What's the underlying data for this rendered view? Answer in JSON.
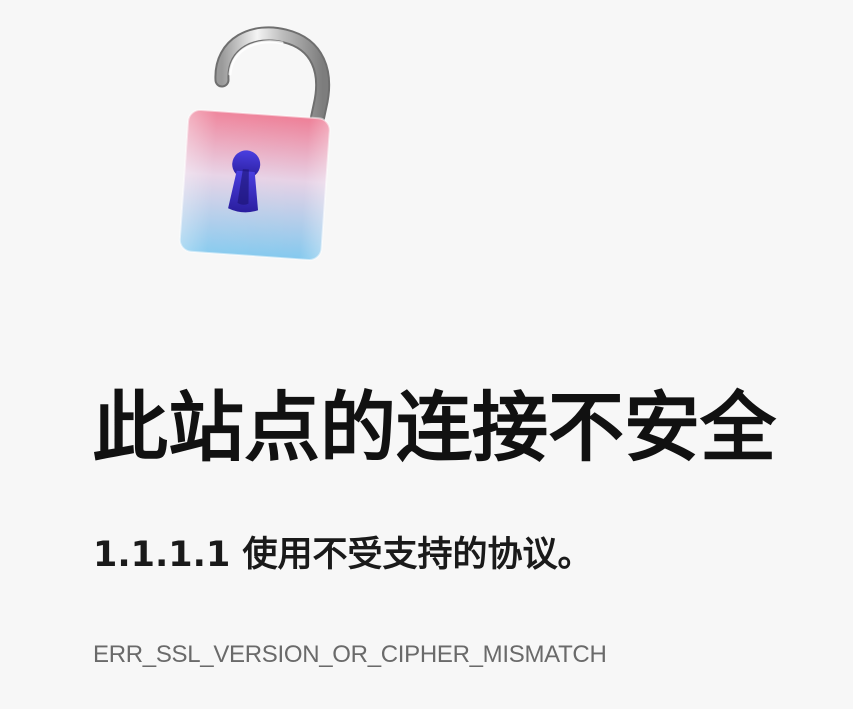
{
  "error_page": {
    "icon": "unlocked-padlock-icon",
    "title": "此站点的连接不安全",
    "description": "1.1.1.1 使用不受支持的协议。",
    "error_code": "ERR_SSL_VERSION_OR_CIPHER_MISMATCH"
  },
  "colors": {
    "background": "#f7f7f7",
    "title": "#111111",
    "error_code": "#6a6a6a",
    "lock_top": "#f08ca0",
    "lock_bottom": "#8fd0f0",
    "keyhole": "#3a28c8"
  }
}
